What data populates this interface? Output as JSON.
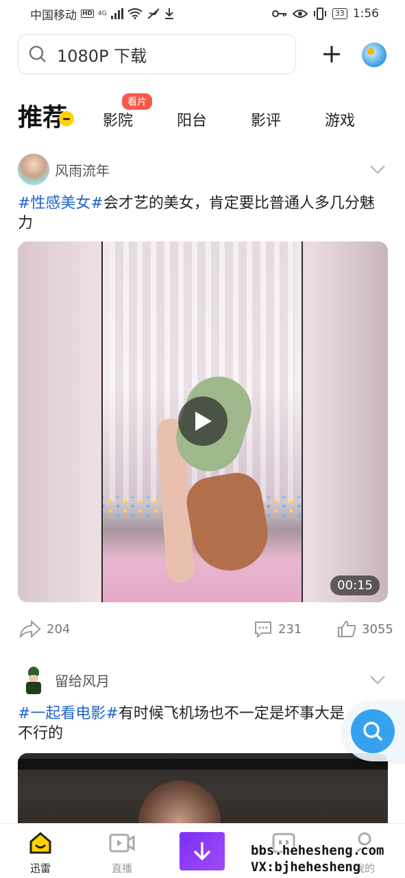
{
  "status_bar": {
    "carrier": "中国移动",
    "hd": "HD",
    "network": "4G",
    "battery": "33",
    "time": "1:56"
  },
  "search": {
    "value": "1080P 下载",
    "placeholder": "1080P 下载"
  },
  "tabs": [
    {
      "label": "推荐",
      "active": true
    },
    {
      "label": "影院",
      "badge": "看片"
    },
    {
      "label": "阳台"
    },
    {
      "label": "影评"
    },
    {
      "label": "游戏"
    }
  ],
  "feed": [
    {
      "user": "风雨流年",
      "hashtag": "#性感美女#",
      "text": "会才艺的美女，肯定要比普通人多几分魅力",
      "duration": "00:15",
      "shares": "204",
      "comments": "231",
      "likes": "3055"
    },
    {
      "user": "留给风月",
      "hashtag": "#一起看电影#",
      "text": "有时候飞机场也不一定是坏事大是不行的"
    }
  ],
  "bottom_nav": [
    {
      "label": "迅雷",
      "active": true
    },
    {
      "label": "直播"
    },
    {
      "label": ""
    },
    {
      "label": ""
    },
    {
      "label": "我的"
    }
  ],
  "watermark": {
    "line1": "bbs.hehesheng.com",
    "line2": "VX:bjhehesheng"
  },
  "colors": {
    "hashtag": "#1f63c8",
    "download_button": "#7b2ff7",
    "float_search": "#35a2ef",
    "tab_badge": "#f45a4a"
  }
}
